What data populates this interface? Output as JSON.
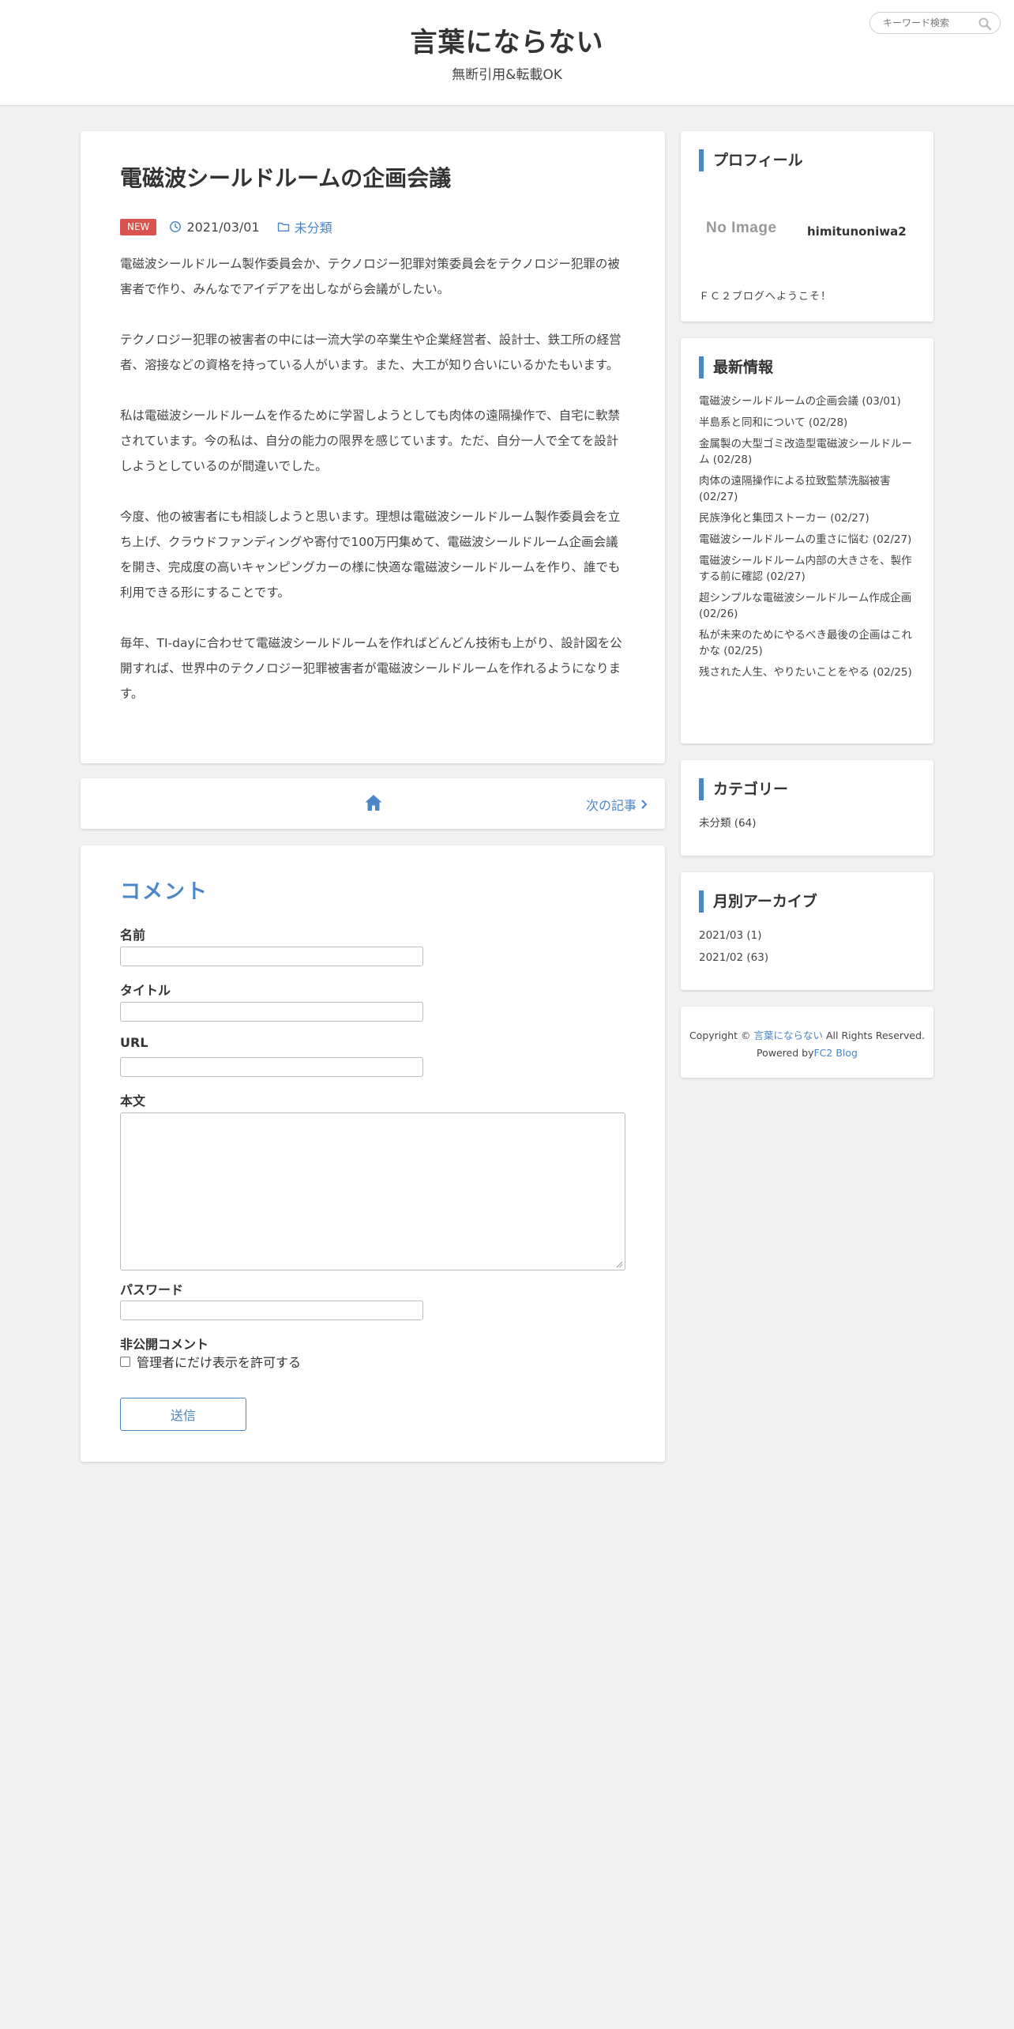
{
  "header": {
    "site_title": "言葉にならない",
    "site_description": "無断引用&転載OK",
    "search_placeholder": "キーワード検索"
  },
  "article": {
    "title": "電磁波シールドルームの企画会議",
    "badge": "NEW",
    "date": "2021/03/01",
    "category": "未分類",
    "paragraphs": [
      "電磁波シールドルーム製作委員会か、テクノロジー犯罪対策委員会をテクノロジー犯罪の被害者で作り、みんなでアイデアを出しながら会議がしたい。",
      "テクノロジー犯罪の被害者の中には一流大学の卒業生や企業経営者、設計士、鉄工所の経営者、溶接などの資格を持っている人がいます。また、大工が知り合いにいるかたもいます。",
      "私は電磁波シールドルームを作るために学習しようとしても肉体の遠隔操作で、自宅に軟禁されています。今の私は、自分の能力の限界を感じています。ただ、自分一人で全てを設計しようとしているのが間違いでした。",
      "今度、他の被害者にも相談しようと思います。理想は電磁波シールドルーム製作委員会を立ち上げ、クラウドファンディングや寄付で100万円集めて、電磁波シールドルーム企画会議を開き、完成度の高いキャンピングカーの様に快適な電磁波シールドルームを作り、誰でも利用できる形にすることです。",
      "毎年、TI-dayに合わせて電磁波シールドルームを作ればどんどん技術も上がり、設計図を公開すれば、世界中のテクノロジー犯罪被害者が電磁波シールドルームを作れるようになります。"
    ]
  },
  "pager": {
    "home_icon": "home-icon",
    "next_label": "次の記事"
  },
  "comment_form": {
    "title": "コメント",
    "name_label": "名前",
    "title_label": "タイトル",
    "url_label": "URL",
    "body_label": "本文",
    "password_label": "パスワード",
    "private_label": "非公開コメント",
    "private_checkbox_label": "管理者にだけ表示を許可する",
    "private_checked": false,
    "submit_label": "送信"
  },
  "sidebar": {
    "profile": {
      "heading": "プロフィール",
      "image_placeholder": "No Image",
      "username": "himitunoniwa2",
      "greeting": "ＦＣ２ブログへようこそ！"
    },
    "recent": {
      "heading": "最新情報",
      "items": [
        "電磁波シールドルームの企画会議 (03/01)",
        "半島系と同和について (02/28)",
        "金属製の大型ゴミ改造型電磁波シールドルーム (02/28)",
        "肉体の遠隔操作による拉致監禁洗脳被害 (02/27)",
        "民族浄化と集団ストーカー (02/27)",
        "電磁波シールドルームの重さに悩む (02/27)",
        "電磁波シールドルーム内部の大きさを、製作する前に確認 (02/27)",
        "超シンプルな電磁波シールドルーム作成企画 (02/26)",
        "私が未来のためにやるべき最後の企画はこれかな (02/25)",
        "残された人生、やりたいことをやる (02/25)"
      ]
    },
    "categories": {
      "heading": "カテゴリー",
      "items": [
        "未分類 (64)"
      ]
    },
    "archive": {
      "heading": "月別アーカイブ",
      "items": [
        "2021/03 (1)",
        "2021/02 (63)"
      ]
    },
    "copyright": {
      "prefix": "Copyright ©",
      "site_link": "言葉にならない",
      "suffix": "All Rights Reserved.",
      "powered_prefix": "Powered by",
      "powered_link": "FC2 Blog"
    }
  },
  "colors": {
    "accent": "#4a86c8",
    "new_badge": "#d9534f",
    "background": "#f1f1f1"
  }
}
